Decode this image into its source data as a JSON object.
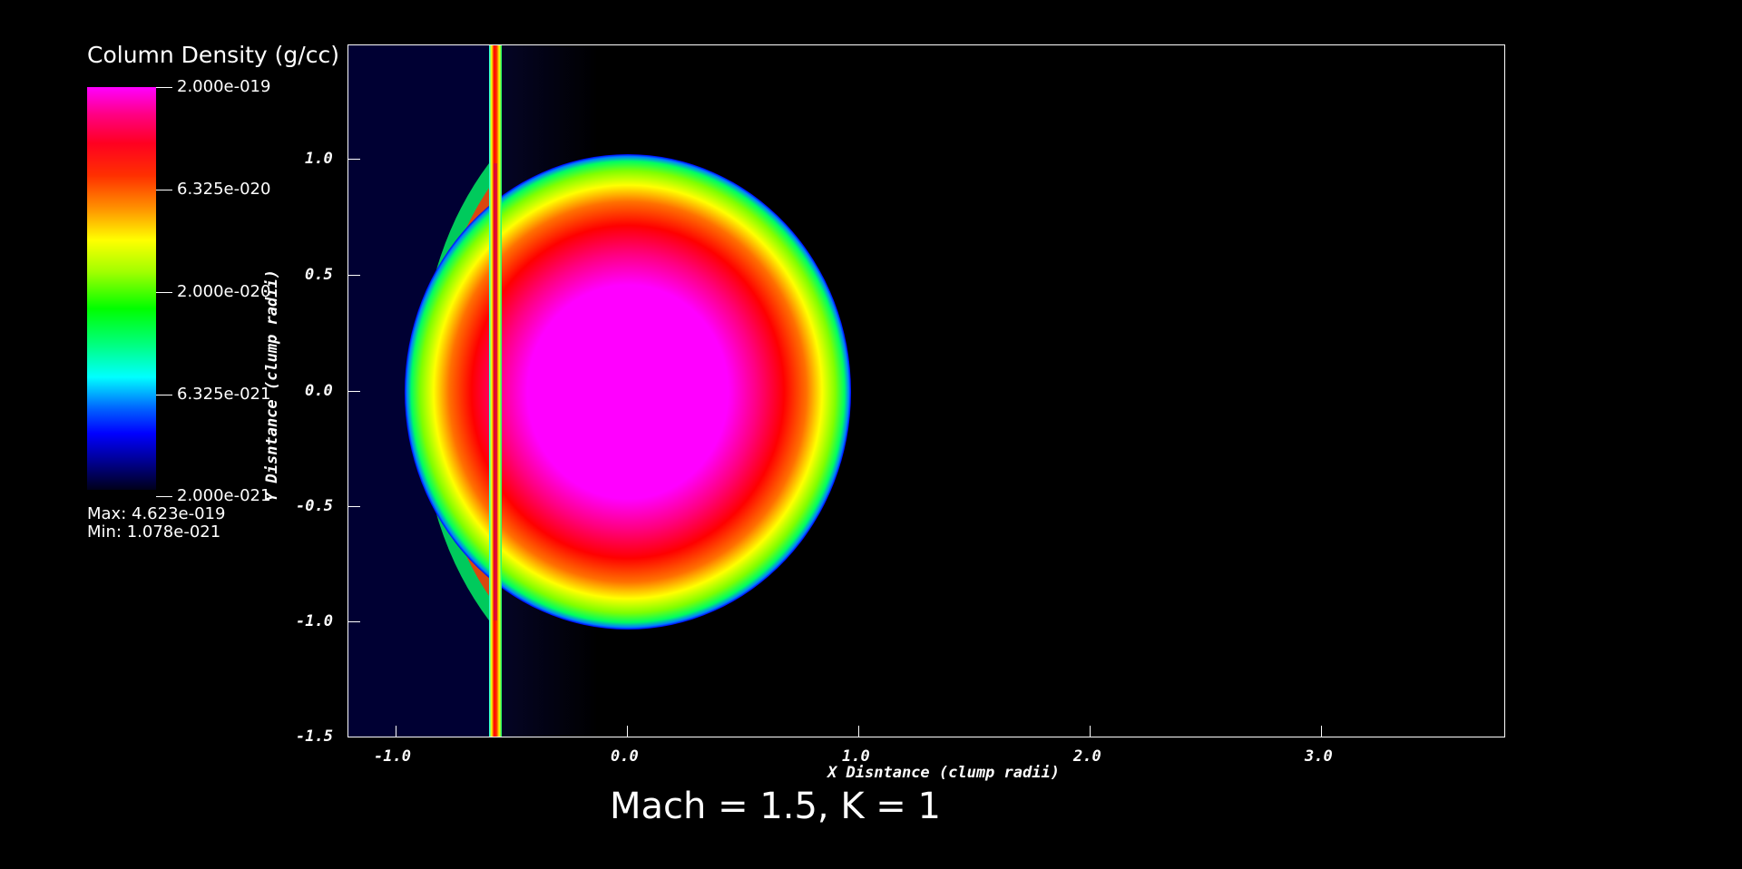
{
  "legend": {
    "title": "Column Density (g/cc)",
    "labels": [
      "2.000e-019",
      "6.325e-020",
      "2.000e-020",
      "6.325e-021",
      "2.000e-021"
    ],
    "max_text": "Max:  4.623e-019",
    "min_text": "Min:  1.078e-021",
    "colormap": [
      "#ff00ff",
      "#ff0000",
      "#ffff00",
      "#00ff00",
      "#00ffff",
      "#0000ff",
      "#000010"
    ]
  },
  "axes": {
    "x_label": "X Disntance (clump radii)",
    "y_label": "Y Disntance (clump radii)",
    "x_ticks": [
      "-1.0",
      "0.0",
      "1.0",
      "2.0",
      "3.0"
    ],
    "y_ticks": [
      "1.0",
      "0.5",
      "0.0",
      "-0.5",
      "-1.0",
      "-1.5"
    ]
  },
  "caption": "Mach = 1.5, K = 1"
}
